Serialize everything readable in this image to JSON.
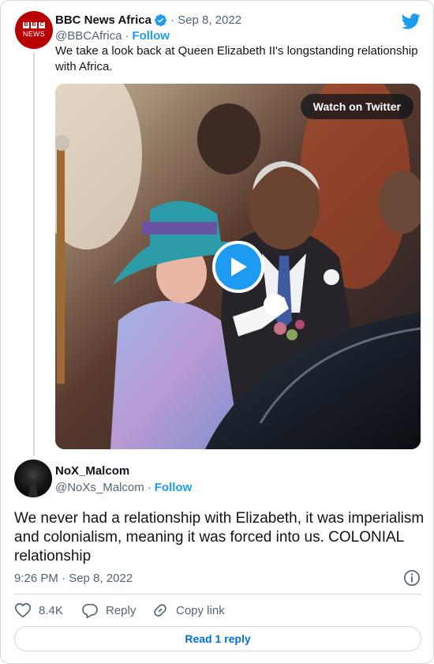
{
  "colors": {
    "accent": "#1d9bf0",
    "text": "#0f1419",
    "muted": "#536471",
    "border": "#cfd9de",
    "bbc_red": "#b80000"
  },
  "parent_tweet": {
    "avatar_logo": {
      "blocks": [
        "B",
        "B",
        "C"
      ],
      "text": "NEWS"
    },
    "display_name": "BBC News Africa",
    "verified_icon": "verified-badge-icon",
    "date": "· Sep 8, 2022",
    "handle": "@BBCAfrica",
    "separator": "·",
    "follow_label": "Follow",
    "text": "We take a look back at Queen Elizabeth II's longstanding relationship with Africa.",
    "media": {
      "watch_label": "Watch on Twitter",
      "play_icon": "play-icon"
    }
  },
  "main_tweet": {
    "display_name": "NoX_Malcom",
    "handle": "@NoXs_Malcom",
    "separator": "·",
    "follow_label": "Follow",
    "text": "We never had a relationship with Elizabeth, it was imperialism and colonialism, meaning it was forced into us. COLONIAL relationship",
    "timestamp": "9:26 PM · Sep 8, 2022",
    "info_icon": "info-icon"
  },
  "actions": {
    "like_count": "8.4K",
    "reply_label": "Reply",
    "copy_link_label": "Copy link"
  },
  "read_reply_label": "Read 1 reply",
  "brand_icon": "twitter-bird-icon"
}
